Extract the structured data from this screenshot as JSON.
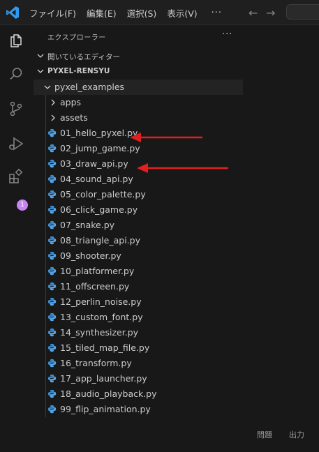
{
  "menu": {
    "items": [
      "ファイル(F)",
      "編集(E)",
      "選択(S)",
      "表示(V)"
    ],
    "more": "···"
  },
  "titlebar": {
    "back_icon": "arrow-left-icon",
    "forward_icon": "arrow-right-icon"
  },
  "activity_bar": {
    "icons": [
      "explorer-icon",
      "search-icon",
      "source-control-icon",
      "run-debug-icon",
      "extensions-icon"
    ],
    "extensions_badge": "1",
    "badge_color": "#c586f0"
  },
  "explorer": {
    "title": "エクスプローラー",
    "more": "···",
    "open_editors": "開いているエディター",
    "workspace": "PYXEL-RENSYU",
    "root_folder": "pyxel_examples",
    "folders": [
      "apps",
      "assets"
    ],
    "files": [
      "01_hello_pyxel.py",
      "02_jump_game.py",
      "03_draw_api.py",
      "04_sound_api.py",
      "05_color_palette.py",
      "06_click_game.py",
      "07_snake.py",
      "08_triangle_api.py",
      "09_shooter.py",
      "10_platformer.py",
      "11_offscreen.py",
      "12_perlin_noise.py",
      "13_custom_font.py",
      "14_synthesizer.py",
      "15_tiled_map_file.py",
      "16_transform.py",
      "17_app_launcher.py",
      "18_audio_playback.py",
      "99_flip_animation.py"
    ]
  },
  "annotations": {
    "arrow_color": "#e02020",
    "pointed_files": [
      "01_hello_pyxel.py",
      "03_draw_api.py"
    ]
  },
  "panel_tabs": [
    "問題",
    "出力"
  ],
  "colors": {
    "accent": "#0078d4",
    "background": "#181818",
    "python_icon": "#3c8fd6"
  }
}
